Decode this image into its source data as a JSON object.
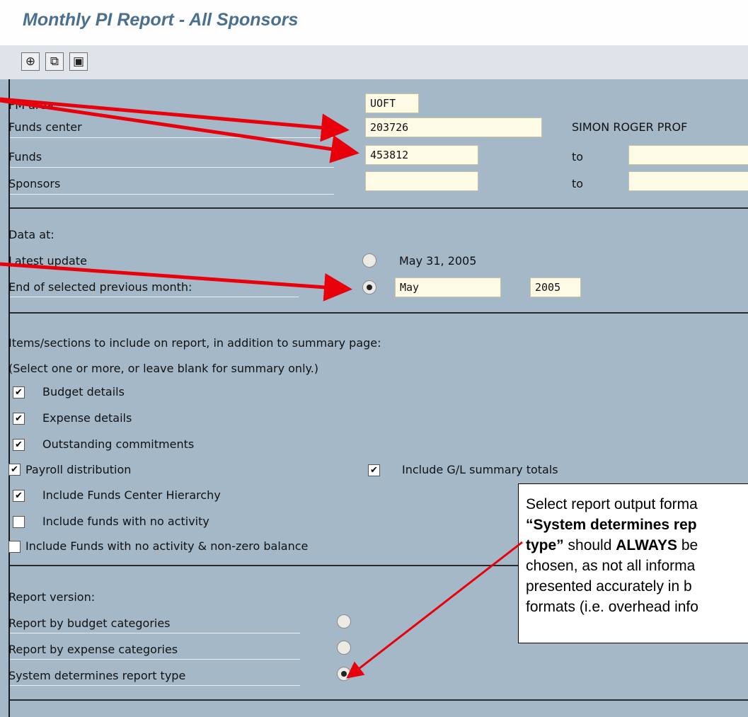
{
  "window": {
    "title": "Monthly PI Report - All Sponsors"
  },
  "toolbar": {
    "icons": [
      "execute-icon",
      "copy-variant-icon",
      "info-icon"
    ]
  },
  "selection": {
    "fm_area_label": "FM area",
    "fm_area_value": "UOFT",
    "funds_center_label": "Funds center",
    "funds_center_value": "203726",
    "funds_center_desc": "SIMON ROGER PROF",
    "funds_label": "Funds",
    "funds_value": "453812",
    "funds_to_label": "to",
    "funds_to_value": "",
    "sponsors_label": "Sponsors",
    "sponsors_value": "",
    "sponsors_to_label": "to",
    "sponsors_to_value": ""
  },
  "data_at": {
    "heading": "Data at:",
    "latest_label": "Latest update",
    "latest_date": "May 31, 2005",
    "latest_selected": false,
    "prev_month_label": "End of selected previous month:",
    "prev_month_selected": true,
    "month_value": "May",
    "year_value": "2005"
  },
  "items": {
    "heading": "Items/sections to include on report, in addition to summary page:",
    "subheading": "(Select one or more, or leave blank for summary only.)",
    "budget_details": "Budget details",
    "expense_details": "Expense details",
    "outstanding_commitments": "Outstanding commitments",
    "payroll_distribution": "Payroll distribution",
    "gl_summary": "Include G/L summary totals",
    "hierarchy": "Include Funds Center Hierarchy",
    "no_activity": "Include funds with no activity",
    "no_activity_balance": "Include Funds with no activity & non-zero balance",
    "check_mark": "✔"
  },
  "version": {
    "heading": "Report version:",
    "by_budget": "Report by budget categories",
    "by_expense": "Report by expense categories",
    "system": "System determines report type"
  },
  "callout": {
    "line1": "Select report output forma",
    "line2_bold": "“System determines rep",
    "line3_bold1": "type”",
    "line3_plain1": " should ",
    "line3_bold2": "ALWAYS",
    "line3_plain2": " be",
    "line4": "chosen, as not all informa",
    "line5": "presented accurately in b",
    "line6": "formats (i.e. overhead info"
  },
  "colors": {
    "title": "#4a6f8f",
    "panel": "#a4b8c8",
    "field": "#fdfbe6",
    "arrow": "#e8000b"
  }
}
